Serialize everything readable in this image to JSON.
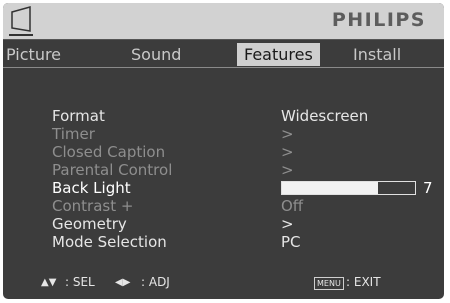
{
  "brand": "PHILIPS",
  "tabs": [
    "Picture",
    "Sound",
    "Features",
    "Install"
  ],
  "menu": {
    "rows": [
      {
        "label": "Format",
        "value": "Widescreen"
      },
      {
        "label": "Timer",
        "value": ">"
      },
      {
        "label": "Closed Caption",
        "value": ">"
      },
      {
        "label": "Parental Control",
        "value": ">"
      },
      {
        "label": "Back Light",
        "value": "7",
        "level_fraction": 0.72
      },
      {
        "label": "Contrast +",
        "value": "Off"
      },
      {
        "label": "Geometry",
        "value": ">"
      },
      {
        "label": "Mode Selection",
        "value": "PC"
      }
    ]
  },
  "footer": {
    "sel_icons": "▲▼",
    "sel_label": ": SEL",
    "adj_icons": "◀▶",
    "adj_label": ": ADJ",
    "menu_key": "MENU",
    "exit_label": ": EXIT"
  }
}
